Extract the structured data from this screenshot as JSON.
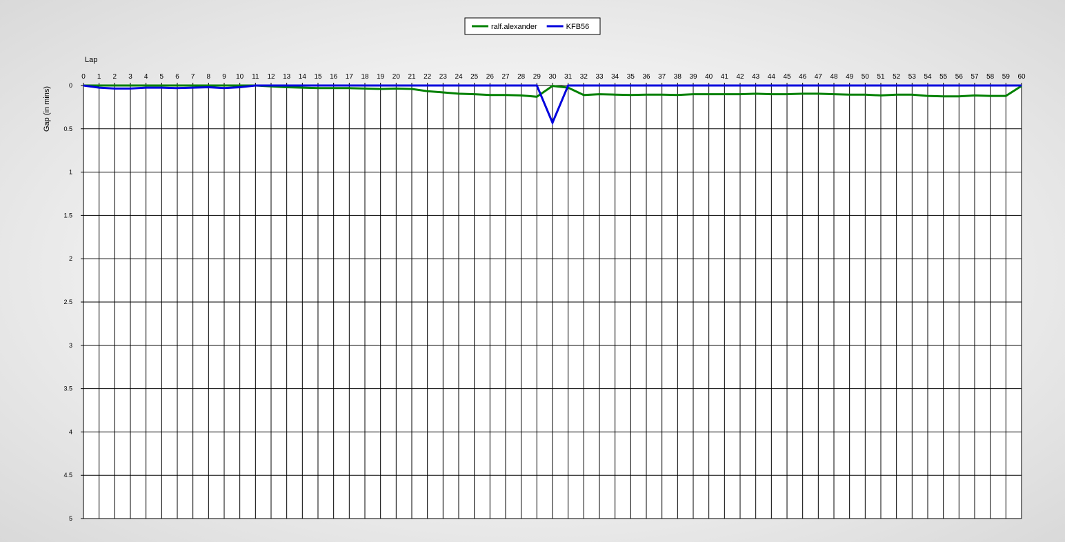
{
  "chart_data": {
    "type": "line",
    "title": "",
    "xlabel": "Lap",
    "ylabel": "Gap (in mins)",
    "x_ticks": [
      "0",
      "1",
      "2",
      "3",
      "4",
      "5",
      "6",
      "7",
      "8",
      "9",
      "10",
      "11",
      "12",
      "13",
      "14",
      "15",
      "16",
      "17",
      "18",
      "19",
      "20",
      "21",
      "22",
      "23",
      "24",
      "25",
      "26",
      "27",
      "28",
      "29",
      "30",
      "31",
      "32",
      "33",
      "34",
      "35",
      "36",
      "37",
      "38",
      "39",
      "40",
      "41",
      "42",
      "43",
      "44",
      "45",
      "46",
      "47",
      "48",
      "49",
      "50",
      "51",
      "52",
      "53",
      "54",
      "55",
      "56",
      "57",
      "58",
      "59",
      "60"
    ],
    "y_ticks": [
      "0",
      "0.5",
      "1",
      "1.5",
      "2",
      "2.5",
      "3",
      "3.5",
      "4",
      "4.5",
      "5"
    ],
    "xlim": [
      0,
      60
    ],
    "ylim": [
      0,
      5
    ],
    "y_inverted": true,
    "x_axis_position": "top",
    "grid": true,
    "legend_position": "top-center",
    "series": [
      {
        "name": "ralf.alexander",
        "color": "#008000",
        "x": [
          0,
          1,
          2,
          3,
          4,
          5,
          6,
          7,
          8,
          9,
          10,
          11,
          12,
          13,
          14,
          15,
          16,
          17,
          18,
          19,
          20,
          21,
          22,
          23,
          24,
          25,
          26,
          27,
          28,
          29,
          30,
          31,
          32,
          33,
          34,
          35,
          36,
          37,
          38,
          39,
          40,
          41,
          42,
          43,
          44,
          45,
          46,
          47,
          48,
          49,
          50,
          51,
          52,
          53,
          54,
          55,
          56,
          57,
          58,
          59,
          60
        ],
        "y": [
          0,
          0,
          0,
          0,
          0,
          0,
          0,
          0,
          0,
          0,
          0,
          0,
          0.01,
          0.02,
          0.025,
          0.03,
          0.03,
          0.03,
          0.035,
          0.04,
          0.035,
          0.04,
          0.065,
          0.08,
          0.095,
          0.1,
          0.11,
          0.11,
          0.115,
          0.13,
          0.005,
          0.025,
          0.11,
          0.1,
          0.105,
          0.11,
          0.105,
          0.105,
          0.11,
          0.1,
          0.1,
          0.1,
          0.1,
          0.095,
          0.1,
          0.1,
          0.095,
          0.095,
          0.1,
          0.105,
          0.105,
          0.115,
          0.105,
          0.105,
          0.12,
          0.125,
          0.125,
          0.115,
          0.12,
          0.12,
          0.005
        ]
      },
      {
        "name": "KFB56",
        "color": "#0000dd",
        "x": [
          0,
          1,
          2,
          3,
          4,
          5,
          6,
          7,
          8,
          9,
          10,
          11,
          12,
          13,
          14,
          15,
          16,
          17,
          18,
          19,
          20,
          21,
          22,
          23,
          24,
          25,
          26,
          27,
          28,
          29,
          30,
          31,
          32,
          33,
          34,
          35,
          36,
          37,
          38,
          39,
          40,
          41,
          42,
          43,
          44,
          45,
          46,
          47,
          48,
          49,
          50,
          51,
          52,
          53,
          54,
          55,
          56,
          57,
          58,
          59,
          60
        ],
        "y": [
          0,
          0.025,
          0.035,
          0.035,
          0.025,
          0.025,
          0.03,
          0.025,
          0.02,
          0.03,
          0.02,
          0,
          0,
          0,
          0,
          0,
          0,
          0,
          0,
          0,
          0,
          0,
          0,
          0,
          0,
          0,
          0,
          0,
          0,
          0,
          0.43,
          0,
          0,
          0,
          0,
          0,
          0,
          0,
          0,
          0,
          0,
          0,
          0,
          0,
          0,
          0,
          0,
          0,
          0,
          0,
          0,
          0,
          0,
          0,
          0,
          0,
          0,
          0,
          0,
          0,
          0
        ]
      }
    ]
  }
}
